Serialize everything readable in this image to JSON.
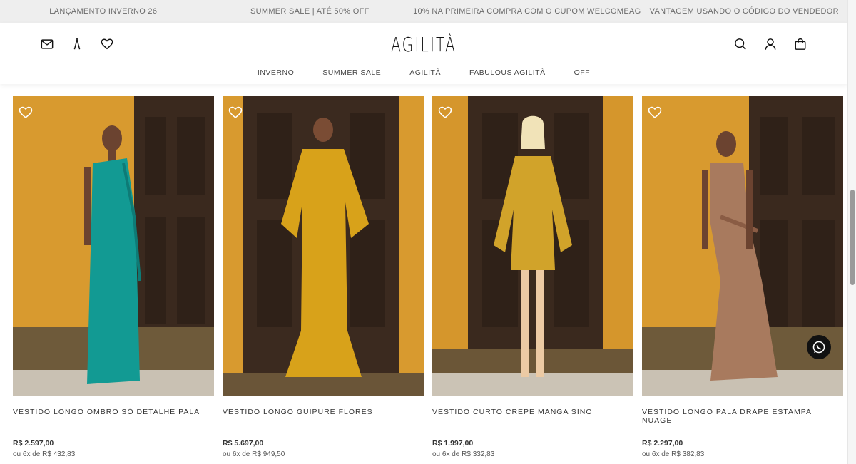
{
  "announcements": [
    "LANÇAMENTO INVERNO 26",
    "SUMMER SALE | ATÉ 50% OFF",
    "10% NA PRIMEIRA COMPRA COM O CUPOM WELCOMEAG",
    "VANTAGEM USANDO O CÓDIGO DO VENDEDOR"
  ],
  "header": {
    "logo": "AGILITÀ",
    "left_icons": [
      "envelope-icon",
      "brand-mark-icon",
      "heart-icon"
    ],
    "right_icons": [
      "search-icon",
      "user-icon",
      "bag-icon"
    ]
  },
  "nav": [
    "INVERNO",
    "SUMMER SALE",
    "AGILITÀ",
    "FABULOUS AGILITÀ",
    "OFF"
  ],
  "products": [
    {
      "name": "VESTIDO LONGO OMBRO SÓ DETALHE PALA",
      "price": "R$ 2.597,00",
      "installments": "ou 6x de  R$ 432,83",
      "dress_color": "#129a93"
    },
    {
      "name": "VESTIDO LONGO GUIPURE FLORES",
      "price": "R$ 5.697,00",
      "installments": "ou 6x de  R$ 949,50",
      "dress_color": "#d8a21a"
    },
    {
      "name": "VESTIDO CURTO CREPE MANGA SINO",
      "price": "R$ 1.997,00",
      "installments": "ou 6x de  R$ 332,83",
      "dress_color": "#d1a32a"
    },
    {
      "name": "VESTIDO LONGO PALA DRAPE ESTAMPA NUAGE",
      "price": "R$ 2.297,00",
      "installments": "ou 6x de  R$ 382,83",
      "dress_color": "#a87a5e"
    }
  ],
  "colors": {
    "wall": "#d99a2e",
    "door": "#3b2a1f",
    "floor": "#c9c1b4"
  },
  "floating": {
    "whatsapp_icon": "whatsapp-icon"
  }
}
